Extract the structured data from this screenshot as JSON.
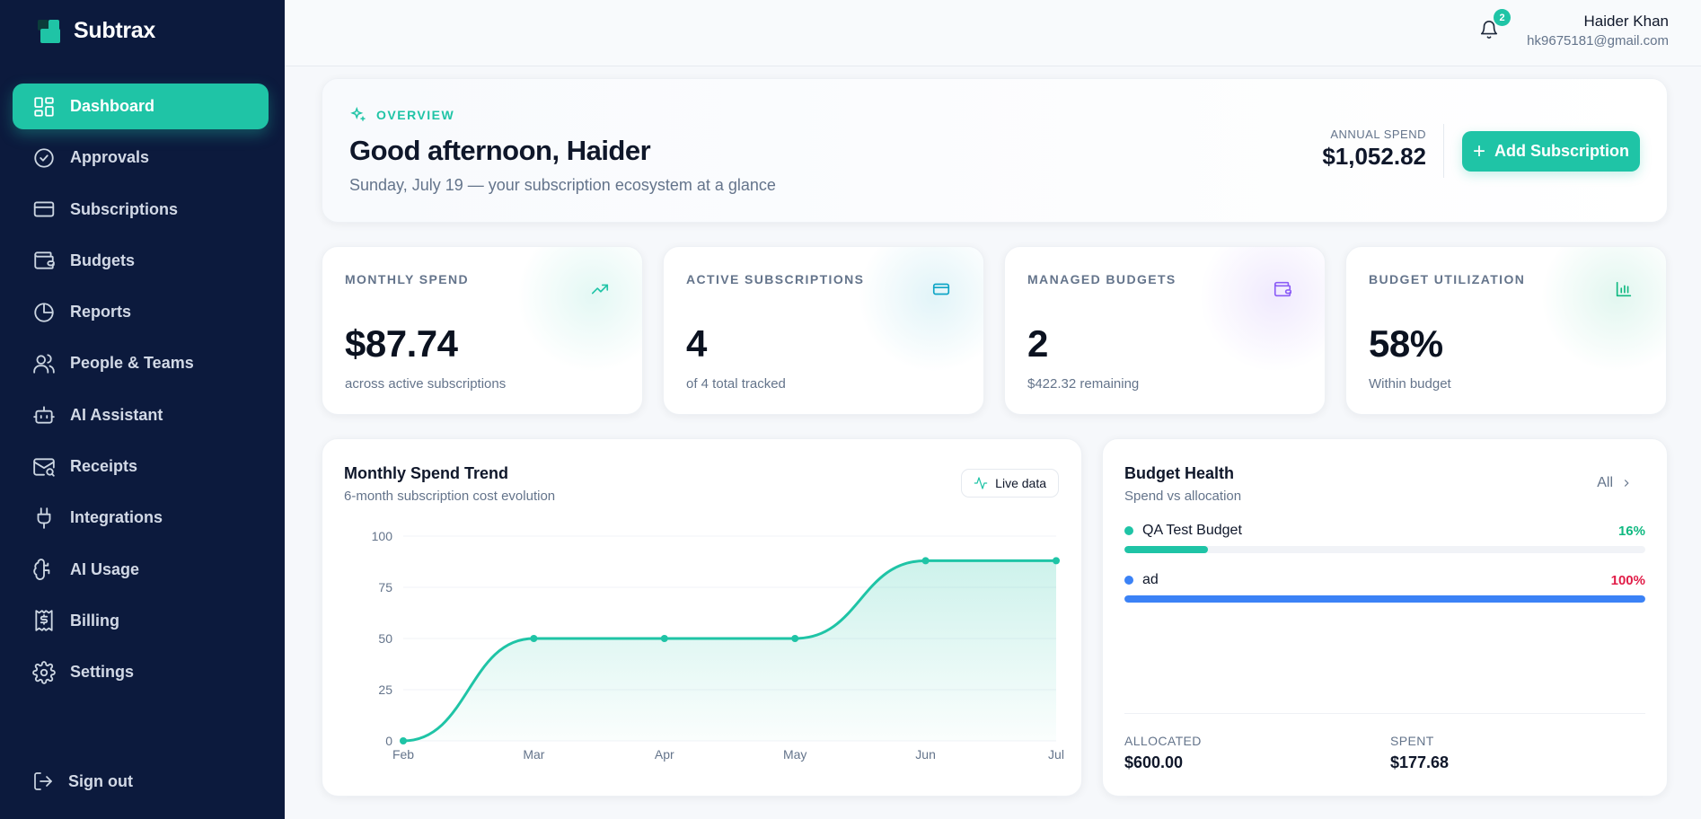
{
  "brand": {
    "name": "Subtrax"
  },
  "sidebar": {
    "items": [
      {
        "label": "Dashboard",
        "icon": "dashboard-icon",
        "active": true
      },
      {
        "label": "Approvals",
        "icon": "check-circle-icon"
      },
      {
        "label": "Subscriptions",
        "icon": "credit-card-icon"
      },
      {
        "label": "Budgets",
        "icon": "wallet-icon"
      },
      {
        "label": "Reports",
        "icon": "pie-chart-icon"
      },
      {
        "label": "People & Teams",
        "icon": "users-icon"
      },
      {
        "label": "AI Assistant",
        "icon": "bot-icon"
      },
      {
        "label": "Receipts",
        "icon": "mail-search-icon"
      },
      {
        "label": "Integrations",
        "icon": "plug-icon"
      },
      {
        "label": "AI Usage",
        "icon": "brain-icon"
      },
      {
        "label": "Billing",
        "icon": "receipt-dollar-icon"
      },
      {
        "label": "Settings",
        "icon": "gear-icon"
      }
    ],
    "signout": "Sign out"
  },
  "topbar": {
    "notification_count": "2",
    "user_name": "Haider Khan",
    "user_email": "hk9675181@gmail.com"
  },
  "overview": {
    "tag": "OVERVIEW",
    "greeting": "Good afternoon, Haider",
    "subtitle": "Sunday, July 19 — your subscription ecosystem at a glance",
    "annual_spend_label": "ANNUAL SPEND",
    "annual_spend_value": "$1,052.82",
    "add_button": "Add Subscription"
  },
  "stats": [
    {
      "label": "MONTHLY SPEND",
      "value": "$87.74",
      "sub": "across active subscriptions",
      "icon": "trending-up-icon",
      "color": "#1fc4a6"
    },
    {
      "label": "ACTIVE SUBSCRIPTIONS",
      "value": "4",
      "sub": "of 4 total tracked",
      "icon": "credit-card-icon",
      "color": "#0ea5c6"
    },
    {
      "label": "MANAGED BUDGETS",
      "value": "2",
      "sub": "$422.32 remaining",
      "icon": "wallet-icon",
      "color": "#8b5cf6"
    },
    {
      "label": "BUDGET UTILIZATION",
      "value": "58%",
      "sub": "Within budget",
      "icon": "bar-chart-icon",
      "color": "#10b981"
    }
  ],
  "trend": {
    "title": "Monthly Spend Trend",
    "subtitle": "6-month subscription cost evolution",
    "badge": "Live data"
  },
  "chart_data": {
    "type": "area",
    "categories": [
      "Feb",
      "Mar",
      "Apr",
      "May",
      "Jun",
      "Jul"
    ],
    "values": [
      0,
      50,
      50,
      50,
      88,
      88
    ],
    "ylim": [
      0,
      100
    ],
    "yticks": [
      "0",
      "25",
      "50",
      "75",
      "100"
    ],
    "grid": true,
    "color": "#1fc4a6"
  },
  "budget_health": {
    "title": "Budget Health",
    "subtitle": "Spend vs allocation",
    "all_link": "All",
    "items": [
      {
        "name": "QA Test Budget",
        "percent_label": "16%",
        "percent": 16,
        "color": "#1fc4a6",
        "pct_color": "#10b981"
      },
      {
        "name": "ad",
        "percent_label": "100%",
        "percent": 100,
        "color": "#3b82f6",
        "pct_color": "#e11d48"
      }
    ],
    "allocated_label": "ALLOCATED",
    "allocated_value": "$600.00",
    "spent_label": "SPENT",
    "spent_value": "$177.68"
  }
}
